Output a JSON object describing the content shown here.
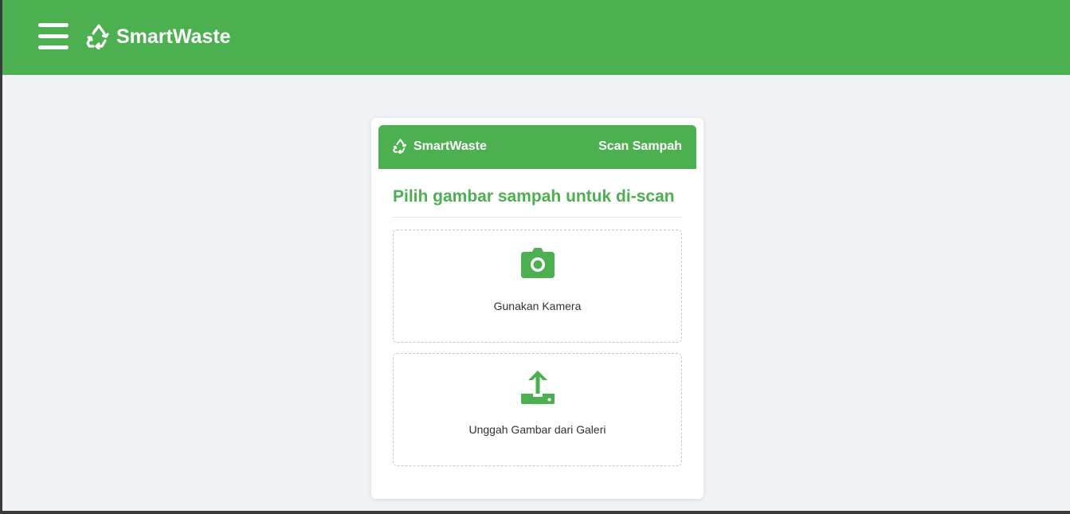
{
  "navbar": {
    "brand_name": "SmartWaste",
    "menu_icon": "hamburger-icon",
    "brand_icon": "recycle-icon",
    "background_color": "#4caf50"
  },
  "card": {
    "header": {
      "brand_name": "SmartWaste",
      "action_label": "Scan Sampah",
      "brand_icon": "recycle-icon"
    },
    "heading": "Pilih gambar sampah untuk di-scan",
    "options": [
      {
        "label": "Gunakan Kamera",
        "icon": "camera-icon"
      },
      {
        "label": "Unggah Gambar dari Galeri",
        "icon": "upload-icon"
      }
    ]
  },
  "colors": {
    "accent": "#4caf50",
    "page_background": "#f0f2f5",
    "text": "#333333"
  }
}
